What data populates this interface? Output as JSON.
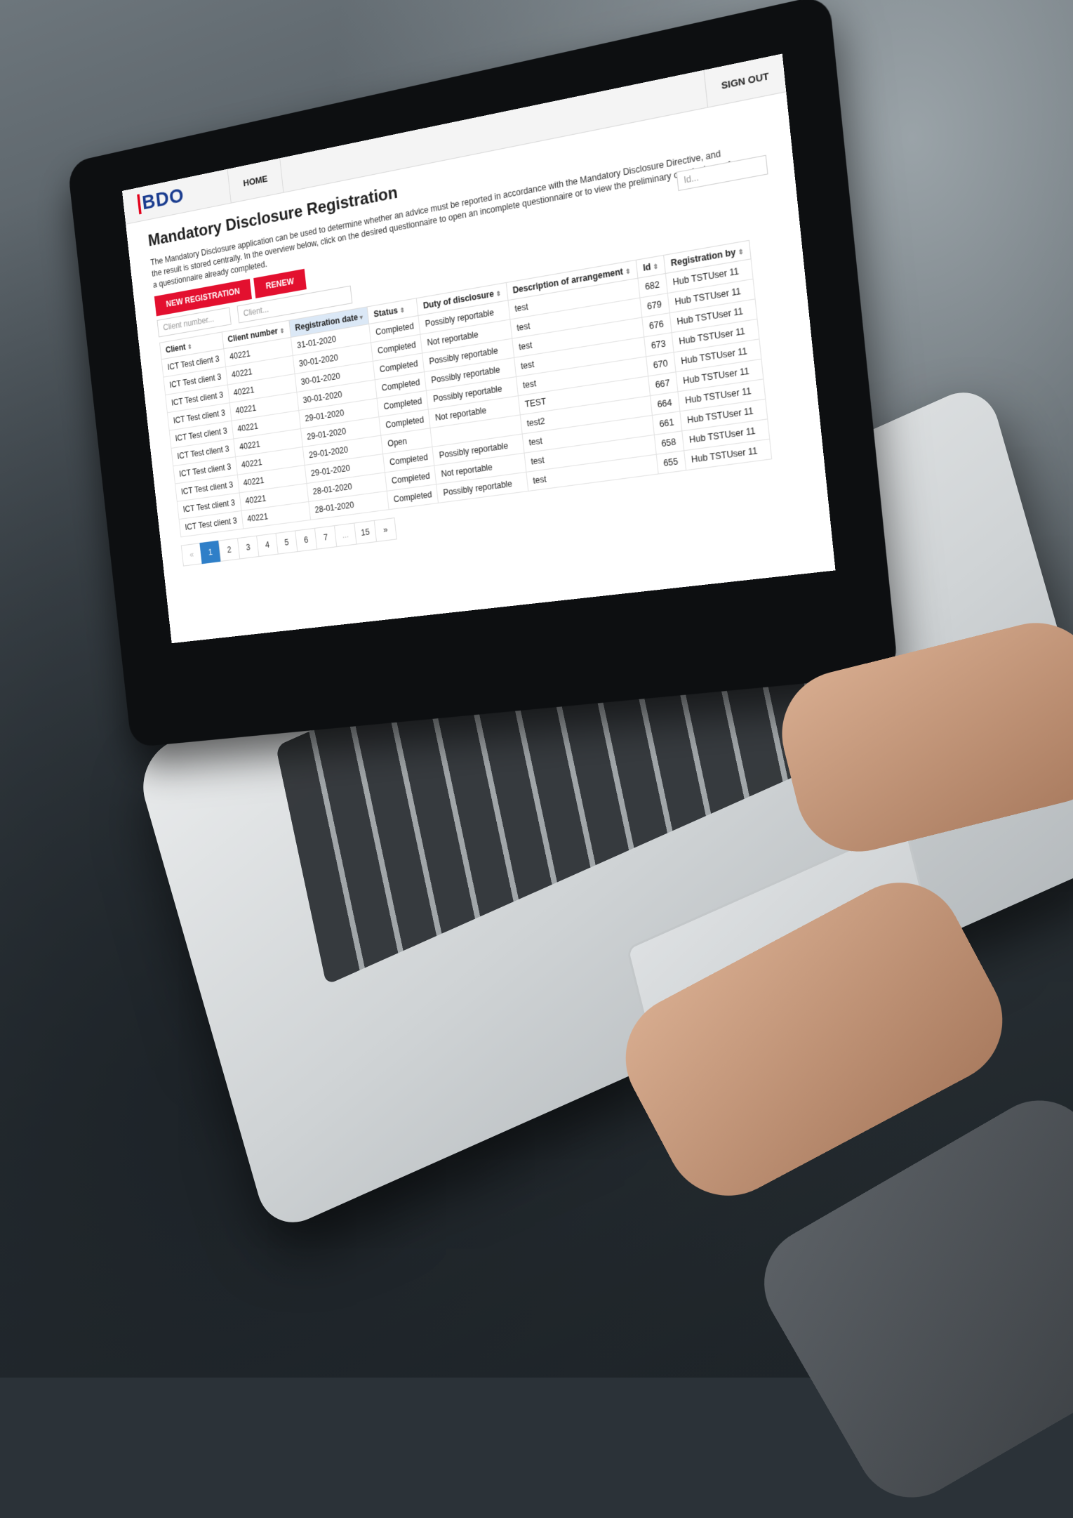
{
  "app": {
    "logo_text": "BDO",
    "nav": [
      {
        "label": "HOME"
      }
    ],
    "signout_label": "SIGN OUT"
  },
  "page": {
    "title": "Mandatory Disclosure Registration",
    "intro": "The Mandatory Disclosure application can be used to determine whether an advice must be reported in accordance with the Mandatory Disclosure Directive, and the result is stored centrally. In the overview below, click on the desired questionnaire to open an incomplete questionnaire or to view the preliminary conclusions of a questionnaire already completed."
  },
  "actions": {
    "new_registration_label": "NEW REGISTRATION",
    "renew_label": "RENEW"
  },
  "filters": {
    "client_number_placeholder": "Client number...",
    "client_placeholder": "Client...",
    "id_placeholder": "Id..."
  },
  "table": {
    "columns": [
      {
        "label": "Client",
        "sort": "⇕"
      },
      {
        "label": "Client number",
        "sort": "⇕"
      },
      {
        "label": "Registration date",
        "sort": "▾"
      },
      {
        "label": "Status",
        "sort": "⇕"
      },
      {
        "label": "Duty of disclosure",
        "sort": "⇕"
      },
      {
        "label": "Description of arrangement",
        "sort": "⇕"
      },
      {
        "label": "Id",
        "sort": "⇕"
      },
      {
        "label": "Registration by",
        "sort": "⇕"
      }
    ],
    "rows": [
      [
        "ICT Test client 3",
        "40221",
        "31-01-2020",
        "Completed",
        "Possibly reportable",
        "test",
        "682",
        "Hub TSTUser 11"
      ],
      [
        "ICT Test client 3",
        "40221",
        "30-01-2020",
        "Completed",
        "Not reportable",
        "test",
        "679",
        "Hub TSTUser 11"
      ],
      [
        "ICT Test client 3",
        "40221",
        "30-01-2020",
        "Completed",
        "Possibly reportable",
        "test",
        "676",
        "Hub TSTUser 11"
      ],
      [
        "ICT Test client 3",
        "40221",
        "30-01-2020",
        "Completed",
        "Possibly reportable",
        "test",
        "673",
        "Hub TSTUser 11"
      ],
      [
        "ICT Test client 3",
        "40221",
        "29-01-2020",
        "Completed",
        "Possibly reportable",
        "test",
        "670",
        "Hub TSTUser 11"
      ],
      [
        "ICT Test client 3",
        "40221",
        "29-01-2020",
        "Completed",
        "Not reportable",
        "TEST",
        "667",
        "Hub TSTUser 11"
      ],
      [
        "ICT Test client 3",
        "40221",
        "29-01-2020",
        "Open",
        "",
        "test2",
        "664",
        "Hub TSTUser 11"
      ],
      [
        "ICT Test client 3",
        "40221",
        "29-01-2020",
        "Completed",
        "Possibly reportable",
        "test",
        "661",
        "Hub TSTUser 11"
      ],
      [
        "ICT Test client 3",
        "40221",
        "28-01-2020",
        "Completed",
        "Not reportable",
        "test",
        "658",
        "Hub TSTUser 11"
      ],
      [
        "ICT Test client 3",
        "40221",
        "28-01-2020",
        "Completed",
        "Possibly reportable",
        "test",
        "655",
        "Hub TSTUser 11"
      ]
    ]
  },
  "pagination": {
    "pages": [
      "«",
      "1",
      "2",
      "3",
      "4",
      "5",
      "6",
      "7",
      "...",
      "15",
      "»"
    ],
    "active": "1"
  }
}
